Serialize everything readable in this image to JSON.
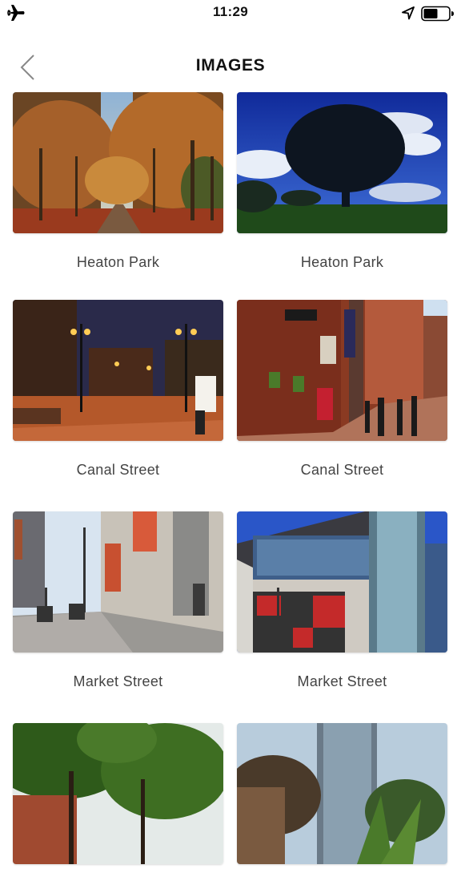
{
  "status_bar": {
    "time": "11:29"
  },
  "nav": {
    "title": "IMAGES"
  },
  "gallery": {
    "items": [
      {
        "label": "Heaton Park"
      },
      {
        "label": "Heaton Park"
      },
      {
        "label": "Canal Street"
      },
      {
        "label": "Canal Street"
      },
      {
        "label": "Market Street"
      },
      {
        "label": "Market Street"
      },
      {
        "label": ""
      },
      {
        "label": ""
      }
    ]
  }
}
